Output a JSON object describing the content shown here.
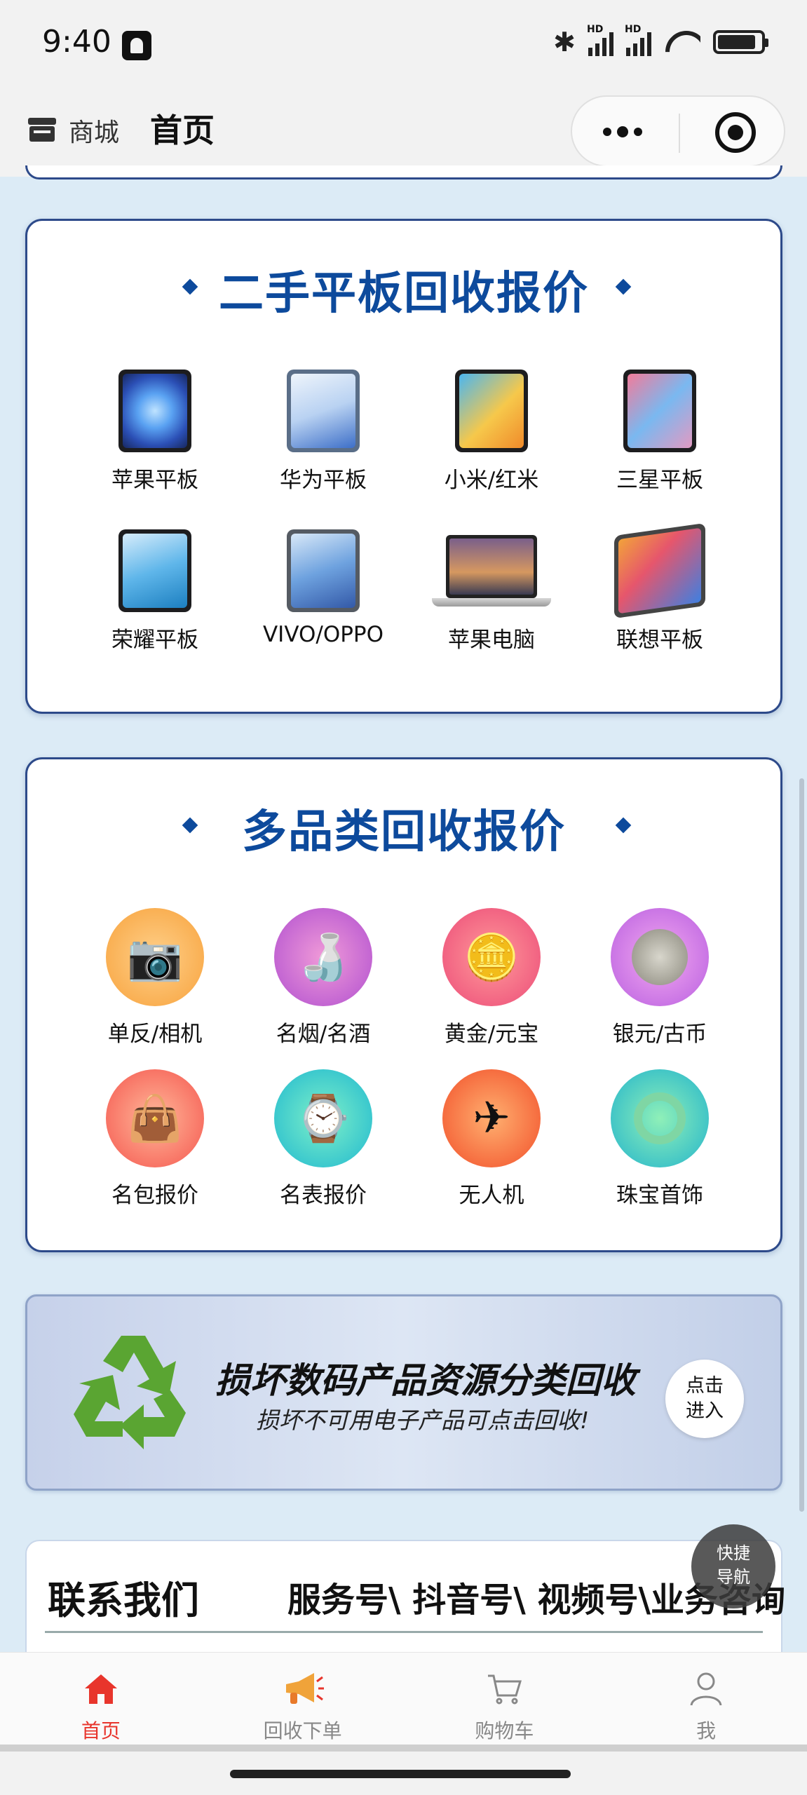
{
  "status": {
    "time": "9:40",
    "hd_label": "HD"
  },
  "titlebar": {
    "shop_label": "商城",
    "page_title": "首页"
  },
  "tablet_section": {
    "title": "二手平板回收报价",
    "items": [
      {
        "label": "苹果平板",
        "icon": "ipad-icon"
      },
      {
        "label": "华为平板",
        "icon": "huawei-tablet-icon"
      },
      {
        "label": "小米/红米",
        "icon": "xiaomi-tablet-icon"
      },
      {
        "label": "三星平板",
        "icon": "samsung-tablet-icon"
      },
      {
        "label": "荣耀平板",
        "icon": "honor-tablet-icon"
      },
      {
        "label": "VIVO/OPPO",
        "icon": "vivo-oppo-tablet-icon"
      },
      {
        "label": "苹果电脑",
        "icon": "macbook-icon"
      },
      {
        "label": "联想平板",
        "icon": "lenovo-tablet-icon"
      }
    ]
  },
  "category_section": {
    "title": "多品类回收报价",
    "items": [
      {
        "label": "单反/相机",
        "icon": "camera-icon",
        "color": "#f7a23c"
      },
      {
        "label": "名烟/名酒",
        "icon": "liquor-icon",
        "color": "#c65bd6"
      },
      {
        "label": "黄金/元宝",
        "icon": "gold-bar-icon",
        "color": "#f05a7a"
      },
      {
        "label": "银元/古币",
        "icon": "silver-coin-icon",
        "color": "#c86be6"
      },
      {
        "label": "名包报价",
        "icon": "handbag-icon",
        "color": "#f6735a"
      },
      {
        "label": "名表报价",
        "icon": "watch-icon",
        "color": "#23c9b8"
      },
      {
        "label": "无人机",
        "icon": "drone-icon",
        "color": "#f56a3a"
      },
      {
        "label": "珠宝首饰",
        "icon": "jade-ring-icon",
        "color": "#2bc7c0"
      }
    ]
  },
  "banner": {
    "title": "损坏数码产品资源分类回收",
    "subtitle": "损坏不可用电子产品可点击回收!",
    "button": "点击\n进入"
  },
  "contact": {
    "title": "联系我们",
    "right_text": "服务号\\ 抖音号\\ 视频号\\业务咨询"
  },
  "fab": {
    "label": "快捷\n导航"
  },
  "tabbar": {
    "items": [
      {
        "label": "首页",
        "icon": "home-icon",
        "active": true
      },
      {
        "label": "回收下单",
        "icon": "megaphone-icon",
        "active": false
      },
      {
        "label": "购物车",
        "icon": "cart-icon",
        "active": false
      },
      {
        "label": "我",
        "icon": "user-icon",
        "active": false
      }
    ]
  },
  "colors": {
    "accent": "#0d4a9c",
    "active_tab": "#e8352c",
    "recycle_green": "#5aa532"
  }
}
